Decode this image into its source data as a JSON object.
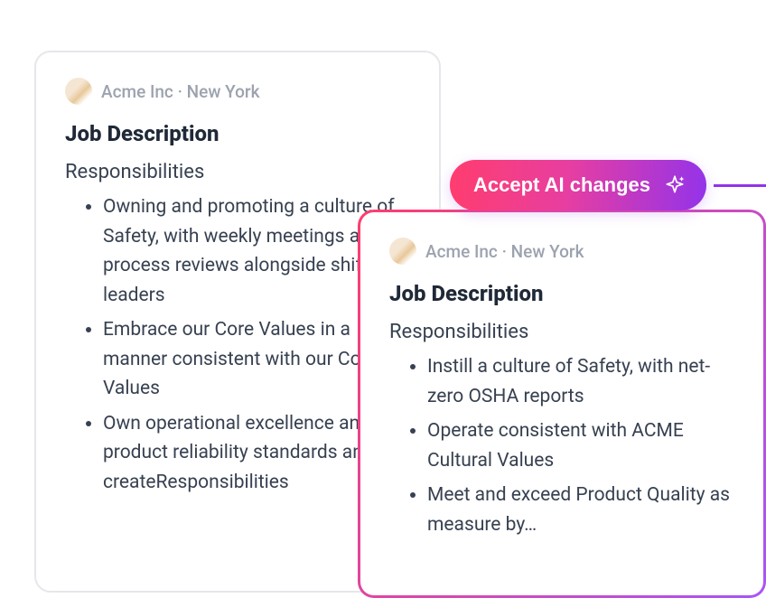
{
  "company": "Acme Inc",
  "location": "New York",
  "meta_separator": " · ",
  "title": "Job Description",
  "subhead": "Responsibilities",
  "accept_button_label": "Accept AI changes",
  "original": {
    "bullets": [
      "Owning and promoting a culture of Safety, with weekly meetings and process reviews alongside shift leaders",
      "Embrace our Core Values in a manner consistent with our Core Values",
      "Own operational excellence and product reliability standards and createResponsibilities"
    ]
  },
  "ai": {
    "bullets": [
      "Instill a culture of Safety, with net-zero OSHA reports",
      "Operate consistent with ACME Cultural Values",
      "Meet and exceed Product Quality as measure by…"
    ]
  }
}
